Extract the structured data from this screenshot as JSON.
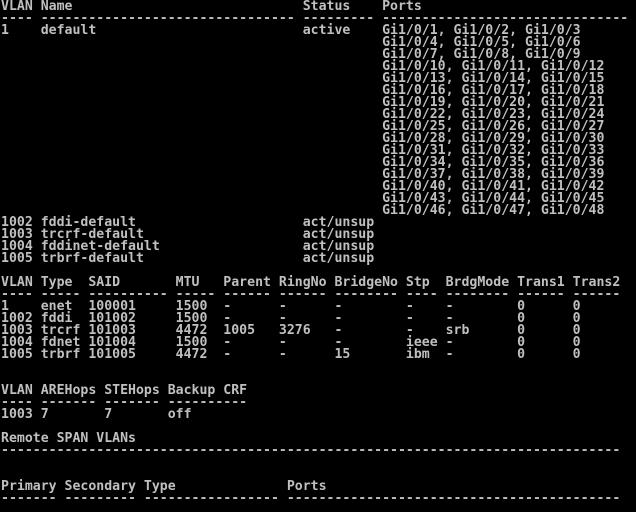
{
  "terminal": {
    "colors": {
      "background": "#000000",
      "foreground": "#c0c0c0"
    },
    "lines": [
      "VLAN Name                             Status    Ports",
      "---- -------------------------------- --------- -------------------------------",
      "1    default                          active    Gi1/0/1, Gi1/0/2, Gi1/0/3",
      "                                                Gi1/0/4, Gi1/0/5, Gi1/0/6",
      "                                                Gi1/0/7, Gi1/0/8, Gi1/0/9",
      "                                                Gi1/0/10, Gi1/0/11, Gi1/0/12",
      "                                                Gi1/0/13, Gi1/0/14, Gi1/0/15",
      "                                                Gi1/0/16, Gi1/0/17, Gi1/0/18",
      "                                                Gi1/0/19, Gi1/0/20, Gi1/0/21",
      "                                                Gi1/0/22, Gi1/0/23, Gi1/0/24",
      "                                                Gi1/0/25, Gi1/0/26, Gi1/0/27",
      "                                                Gi1/0/28, Gi1/0/29, Gi1/0/30",
      "                                                Gi1/0/31, Gi1/0/32, Gi1/0/33",
      "                                                Gi1/0/34, Gi1/0/35, Gi1/0/36",
      "                                                Gi1/0/37, Gi1/0/38, Gi1/0/39",
      "                                                Gi1/0/40, Gi1/0/41, Gi1/0/42",
      "                                                Gi1/0/43, Gi1/0/44, Gi1/0/45",
      "                                                Gi1/0/46, Gi1/0/47, Gi1/0/48",
      "1002 fddi-default                     act/unsup",
      "1003 trcrf-default                    act/unsup",
      "1004 fddinet-default                  act/unsup",
      "1005 trbrf-default                    act/unsup",
      "",
      "VLAN Type  SAID       MTU   Parent RingNo BridgeNo Stp  BrdgMode Trans1 Trans2",
      "---- ----- ---------- ----- ------ ------ -------- ---- -------- ------ ------",
      "1    enet  100001     1500  -      -      -        -    -        0      0",
      "1002 fddi  101002     1500  -      -      -        -    -        0      0",
      "1003 trcrf 101003     4472  1005   3276   -        -    srb      0      0",
      "1004 fdnet 101004     1500  -      -      -        ieee -        0      0",
      "1005 trbrf 101005     4472  -      -      15       ibm  -        0      0",
      "",
      "",
      "VLAN AREHops STEHops Backup CRF",
      "---- ------- ------- ----------",
      "1003 7       7       off",
      "",
      "Remote SPAN VLANs",
      "------------------------------------------------------------------------------",
      "",
      "",
      "Primary Secondary Type              Ports",
      "------- --------- ----------------- ------------------------------------------"
    ]
  }
}
